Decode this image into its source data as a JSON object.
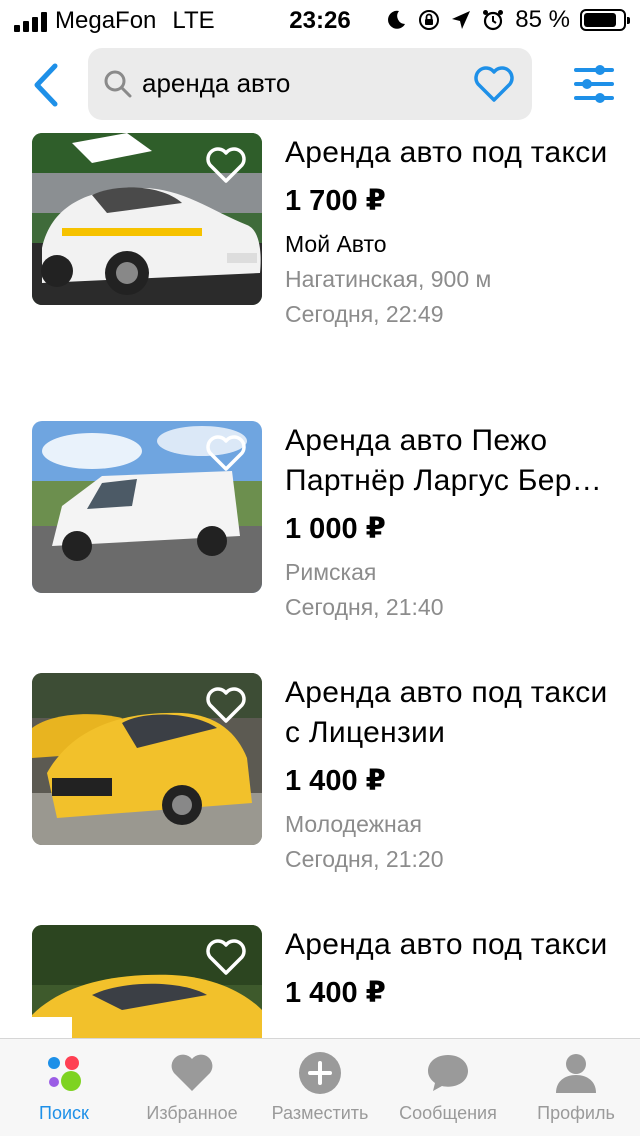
{
  "status_bar": {
    "carrier": "MegaFon",
    "network": "LTE",
    "time": "23:26",
    "battery": "85 %",
    "battery_level": 0.85
  },
  "search": {
    "query": "аренда авто"
  },
  "listings": [
    {
      "title": "Аренда авто под такси",
      "price": "1 700 ₽",
      "seller": "Мой Авто",
      "location": "Нагатинская, 900 м",
      "date": "Сегодня, 22:49"
    },
    {
      "title": "Аренда авто Пежо Партнёр Ларгус Бер…",
      "price": "1 000 ₽",
      "location": "Римская",
      "date": "Сегодня, 21:40"
    },
    {
      "title": "Аренда авто под такси с Лицензии",
      "price": "1 400 ₽",
      "location": "Молодежная",
      "date": "Сегодня, 21:20"
    },
    {
      "title": "Аренда авто под такси",
      "price": "1 400 ₽"
    }
  ],
  "tabs": [
    {
      "label": "Поиск",
      "icon": "avito-logo-icon",
      "active": true
    },
    {
      "label": "Избранное",
      "icon": "heart-icon"
    },
    {
      "label": "Разместить",
      "icon": "plus-circle-icon"
    },
    {
      "label": "Сообщения",
      "icon": "chat-bubble-icon"
    },
    {
      "label": "Профиль",
      "icon": "person-icon"
    }
  ],
  "colors": {
    "accent": "#1e90e8",
    "muted_text": "#8c8c8c",
    "search_bg": "#ebebeb"
  }
}
